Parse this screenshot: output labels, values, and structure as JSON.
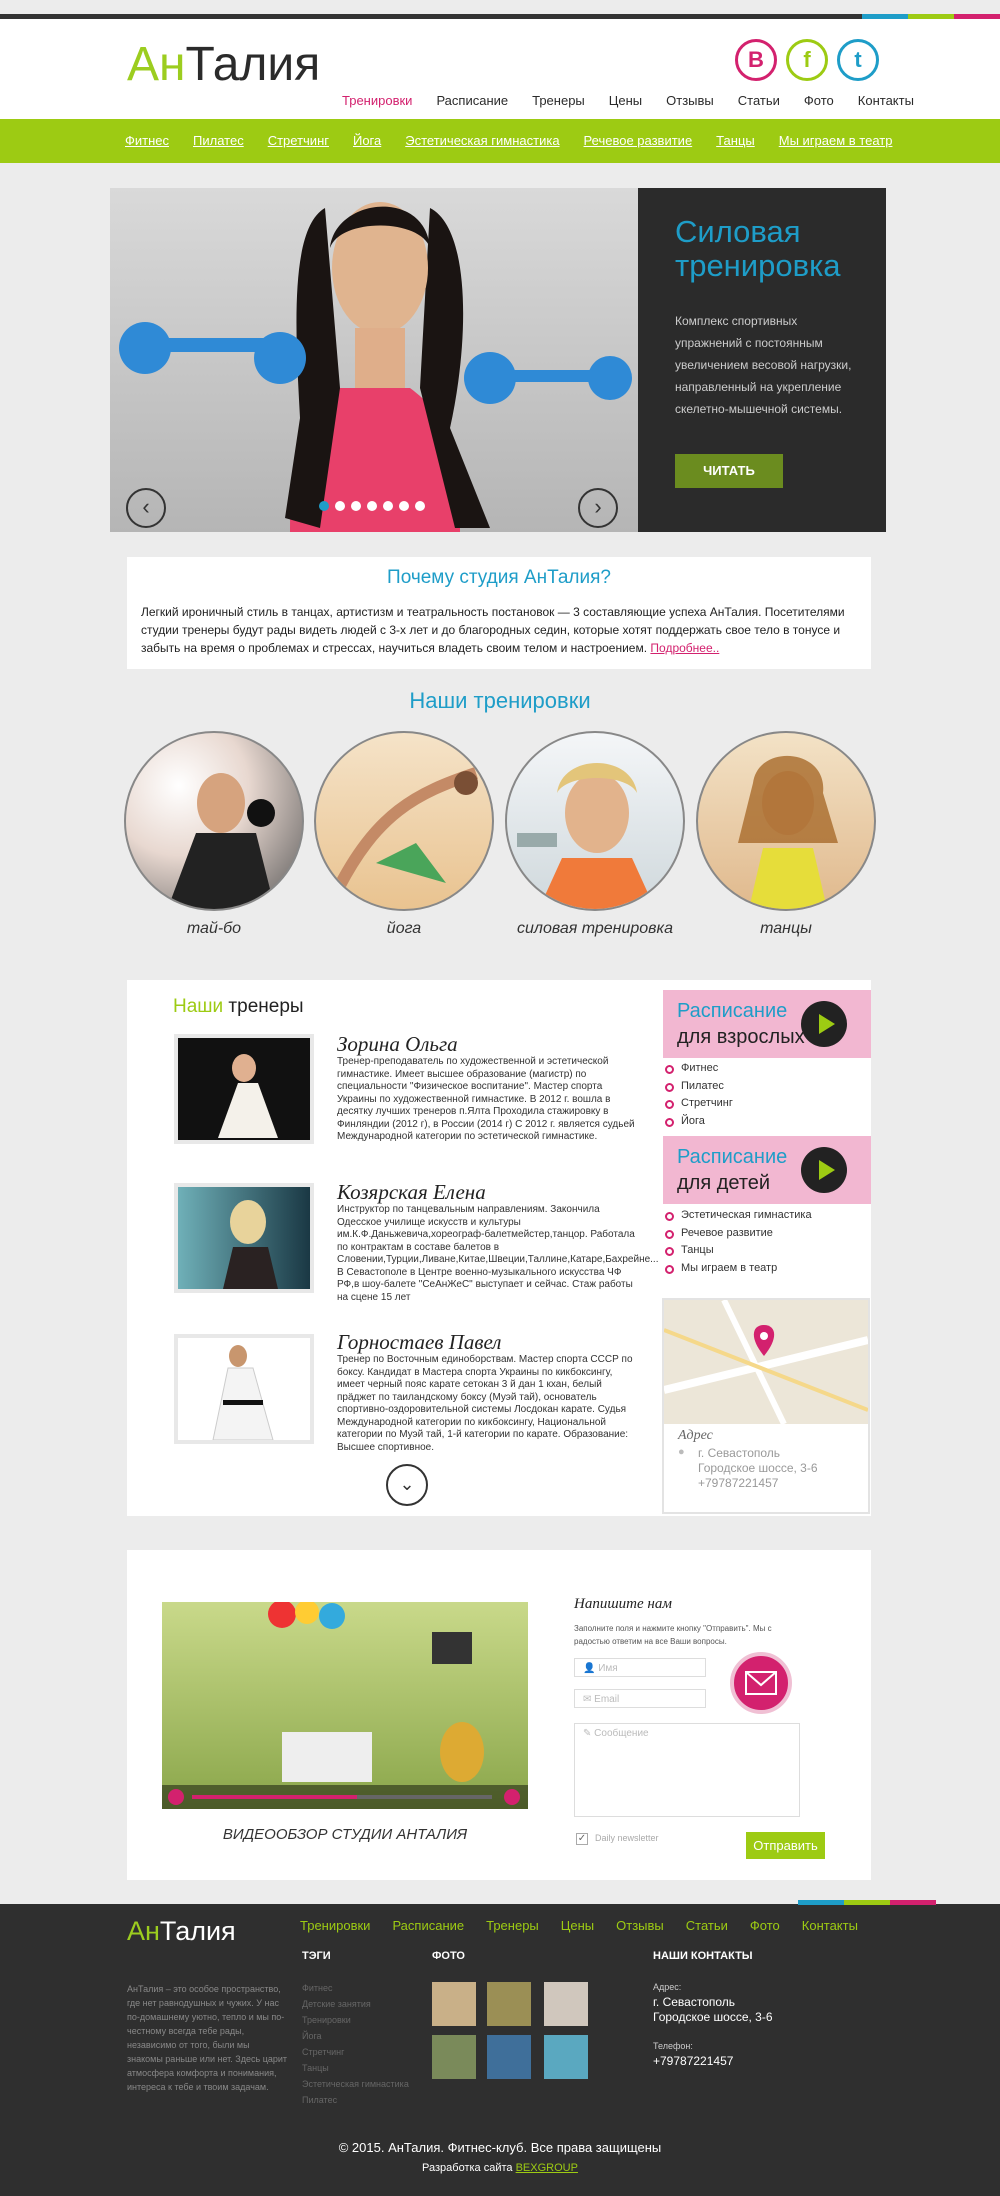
{
  "logo": {
    "part1": "Ан",
    "part2": "Талия"
  },
  "social": [
    "B",
    "f",
    "t"
  ],
  "nav": [
    "Тренировки",
    "Расписание",
    "Тренеры",
    "Цены",
    "Отзывы",
    "Статьи",
    "Фото",
    "Контакты"
  ],
  "subnav": [
    "Фитнес",
    "Пилатес",
    "Стретчинг",
    "Йога",
    "Эстетическая гимнастика",
    "Речевое развитие",
    "Танцы",
    "Мы играем в театр"
  ],
  "hero": {
    "title_line1": "Силовая",
    "title_line2": "тренировка",
    "text": "Комплекс спортивных упражнений с постоянным увеличением весовой нагрузки, направленный на укрепление скелетно-мышечной системы.",
    "button": "ЧИТАТЬ",
    "slides": 7,
    "active_slide": 0
  },
  "why": {
    "title": "Почему студия АнТалия?",
    "text": "Легкий ироничный стиль в танцах, артистизм и театральность постановок — 3 составляющие успеха АнТалия. Посетителями студии тренеры будут рады видеть людей с 3-х лет и до благородных седин, которые хотят поддержать свое тело в тонусе и забыть на время о проблемах и стрессах, научиться владеть своим телом и настроением.",
    "link": "Подробнее.."
  },
  "trainings": {
    "title": "Наши тренировки",
    "items": [
      "тай-бо",
      "йога",
      "силовая тренировка",
      "танцы"
    ]
  },
  "trainers": {
    "title_a": "Наши",
    "title_b": " тренеры",
    "items": [
      {
        "name": "Зорина Ольга",
        "bio": "Тренер-преподаватель по художественной и эстетической гимнастике. Имеет высшее образование (магистр) по специальности \"Физическое воспитание\". Мастер спорта Украины по художественной гимнастике. В 2012 г. вошла в десятку лучших тренеров п.Ялта Проходила стажировку в Финляндии (2012 г), в России (2014 г) С 2012 г. является судьей Международной категории по эстетической гимнастике."
      },
      {
        "name": "Козярская Елена",
        "bio": "Инструктор по танцевальным направлениям. Закончила Одесское училище искусств и культуры им.К.Ф.Даньжевича,хореограф-балетмейстер,танцор. Работала по контрактам в составе балетов в Словении,Турции,Ливане,Китае,Швеции,Таллине,Катаре,Бахрейне... В Севастополе в Центре военно-музыкального искусства ЧФ РФ,в шоу-балете \"СеАнЖеС\" выступает и сейчас. Стаж работы на сцене 15 лет"
      },
      {
        "name": "Горностаев Павел",
        "bio": "Тренер по Восточным единоборствам. Мастер спорта СССР по боксу. Кандидат в Мастера спорта Украины по кикбоксингу, имеет черный пояс карате сетокан 3 й дан 1 кхан, белый прäджет по таиландскому боксу (Муэй тай), основатель спортивно-оздоровительной системы Лосдокан карате. Судья Международной категории по кикбоксингу, Национальной категории по Муэй тай, 1-й категории по карате. Образование: Высшее спортивное."
      }
    ]
  },
  "schedule_adults": {
    "line1": "Расписание",
    "line2": "для взрослых",
    "items": [
      "Фитнес",
      "Пилатес",
      "Стретчинг",
      "Йога"
    ]
  },
  "schedule_kids": {
    "line1": "Расписание",
    "line2": "для детей",
    "items": [
      "Эстетическая гимнастика",
      "Речевое развитие",
      "Танцы",
      "Мы играем в театр"
    ]
  },
  "address": {
    "label": "Адрес",
    "city": "г. Севастополь",
    "street": "Городское шоссе, 3-6",
    "phone": "+79787221457"
  },
  "video": {
    "caption": "ВИДЕООБЗОР СТУДИИ АНТАЛИЯ",
    "progress": 0.55
  },
  "contact": {
    "title": "Напишите нам",
    "text": "Заполните поля и нажмите кнопку \"Отправить\". Мы с радостью ответим на все Ваши вопросы.",
    "name_placeholder": "Имя",
    "email_placeholder": "Email",
    "message_placeholder": "Сообщение",
    "newsletter": "Daily newsletter",
    "submit": "Отправить"
  },
  "footer": {
    "nav": [
      "Тренировки",
      "Расписание",
      "Тренеры",
      "Цены",
      "Отзывы",
      "Статьи",
      "Фото",
      "Контакты"
    ],
    "about": "АнТалия – это особое пространство, где нет равнодушных и чужих. У нас по-домашнему уютно, тепло и мы по-честному всегда тебе рады, независимо от того, были мы знакомы раньше или нет. Здесь царит атмосфера комфорта и понимания, интереса к тебе и твоим задачам.",
    "tags_title": "ТЭГИ",
    "tags": [
      "Фитнес",
      "Детские занятия",
      "Тренировки",
      "Йога",
      "Стретчинг",
      "Танцы",
      "Эстетическая гимнастика",
      "Пилатес"
    ],
    "photo_title": "ФОТО",
    "contacts_title": "НАШИ КОНТАКТЫ",
    "addr_label": "Адрес:",
    "addr_city": "г. Севастополь",
    "addr_street": "Городское шоссе, 3-6",
    "phone_label": "Телефон:",
    "phone": "+79787221457",
    "copyright": "© 2015. АнТалия. Фитнес-клуб. Все права защищены",
    "dev_label": "Разработка сайта ",
    "dev_link": "BEXGROUP"
  },
  "colors": {
    "accent_green": "#9dcb13",
    "accent_pink": "#d3216e",
    "accent_blue": "#1e9dc8"
  }
}
